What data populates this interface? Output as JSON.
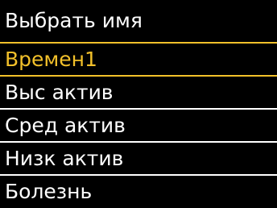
{
  "header": {
    "title": "Выбрать имя"
  },
  "menu": {
    "selected_index": 0,
    "items": [
      {
        "label": "Времен1"
      },
      {
        "label": "Выс актив"
      },
      {
        "label": "Сред актив"
      },
      {
        "label": "Низк актив"
      },
      {
        "label": "Болезнь"
      }
    ]
  },
  "colors": {
    "background": "#000000",
    "text": "#ffffff",
    "accent": "#f2c02a"
  }
}
